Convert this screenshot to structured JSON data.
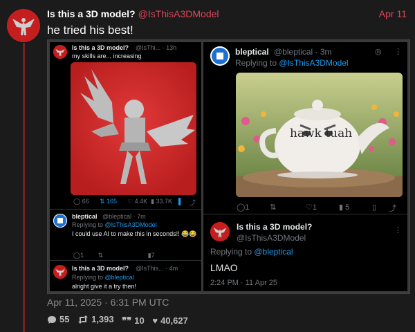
{
  "post": {
    "author_name": "Is this a 3D model?",
    "author_handle": "@IsThisA3DModel",
    "date": "Apr 11",
    "text": "he tried his best!",
    "timestamp": "Apr 11, 2025 · 6:31 PM UTC",
    "stats": {
      "replies": "55",
      "reposts": "1,393",
      "quotes": "10",
      "likes": "40,627"
    }
  },
  "left_panel": {
    "tweet1": {
      "name": "Is this a 3D model?",
      "meta": "@IsThi... · 13h",
      "text": "my skills are... increasing",
      "actions": {
        "replies": "66",
        "reposts": "165",
        "likes": "4.4K",
        "views": "33.7K"
      }
    },
    "tweet2": {
      "name": "bleptical",
      "meta": "@bleptical · 7m",
      "replying_prefix": "Replying to ",
      "replying_to": "@IsThisA3DModel",
      "text": "I could use AI to make this in seconds!! 😂😂",
      "actions": {
        "replies": "1",
        "views": "7"
      }
    },
    "tweet3": {
      "name": "Is this a 3D model?",
      "meta": "@IsThis... · 4m",
      "replying_prefix": "Replying to ",
      "replying_to": "@bleptical",
      "text": "alright give it a try then!"
    }
  },
  "right_panel": {
    "tweet1": {
      "name": "bleptical",
      "meta": "@bleptical · 3m",
      "replying_prefix": "Replying to ",
      "replying_to": "@IsThisA3DModel",
      "teapot_text": "hawk tuah",
      "actions": {
        "replies": "1",
        "likes": "1",
        "views": "5"
      }
    },
    "tweet2": {
      "name": "Is this a 3D model?",
      "handle": "@IsThisA3DModel",
      "replying_prefix": "Replying to ",
      "replying_to": "@bleptical",
      "text": "LMAO",
      "timestamp": "2:24 PM · 11 Apr 25"
    }
  },
  "colors": {
    "accent_red": "#e0455a",
    "link_blue": "#1d9bf0",
    "avatar_red": "#c41e1e"
  }
}
